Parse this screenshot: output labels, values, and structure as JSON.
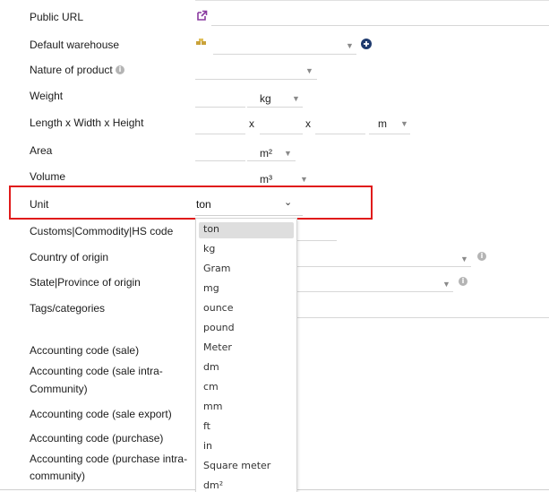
{
  "labels": {
    "public_url": "Public URL",
    "default_warehouse": "Default warehouse",
    "nature_of_product": "Nature of product",
    "weight": "Weight",
    "dimensions": "Length x Width x Height",
    "area": "Area",
    "volume": "Volume",
    "unit": "Unit",
    "customs": "Customs|Commodity|HS code",
    "country_of_origin": "Country of origin",
    "state_of_origin": "State|Province of origin",
    "tags": "Tags/categories",
    "acc_sale": "Accounting code (sale)",
    "acc_sale_intra_1": "Accounting code (sale intra-",
    "acc_sale_intra_2": "Community)",
    "acc_sale_export": "Accounting code (sale export)",
    "acc_purchase": "Accounting code (purchase)",
    "acc_purchase_intra_1": "Accounting code (purchase intra-",
    "acc_purchase_intra_2": "community)"
  },
  "units": {
    "weight": "kg",
    "dim_sep_1": "x",
    "dim_sep_2": "x",
    "dimensions": "m",
    "area": "m²",
    "volume": "m³"
  },
  "unit_select": {
    "value": "ton",
    "options": [
      "ton",
      "kg",
      "Gram",
      "mg",
      "ounce",
      "pound",
      "Meter",
      "dm",
      "cm",
      "mm",
      "ft",
      "in",
      "Square meter",
      "dm²"
    ]
  },
  "icons": {
    "external_link": "external-link-icon",
    "warehouse": "warehouse-icon",
    "add": "plus-circle-icon",
    "info": "info-icon"
  },
  "colors": {
    "highlight": "#e01b1b",
    "link_icon": "#8a3aa0",
    "add_button": "#1e3a6e",
    "warehouse_icon": "#c9a23a"
  }
}
